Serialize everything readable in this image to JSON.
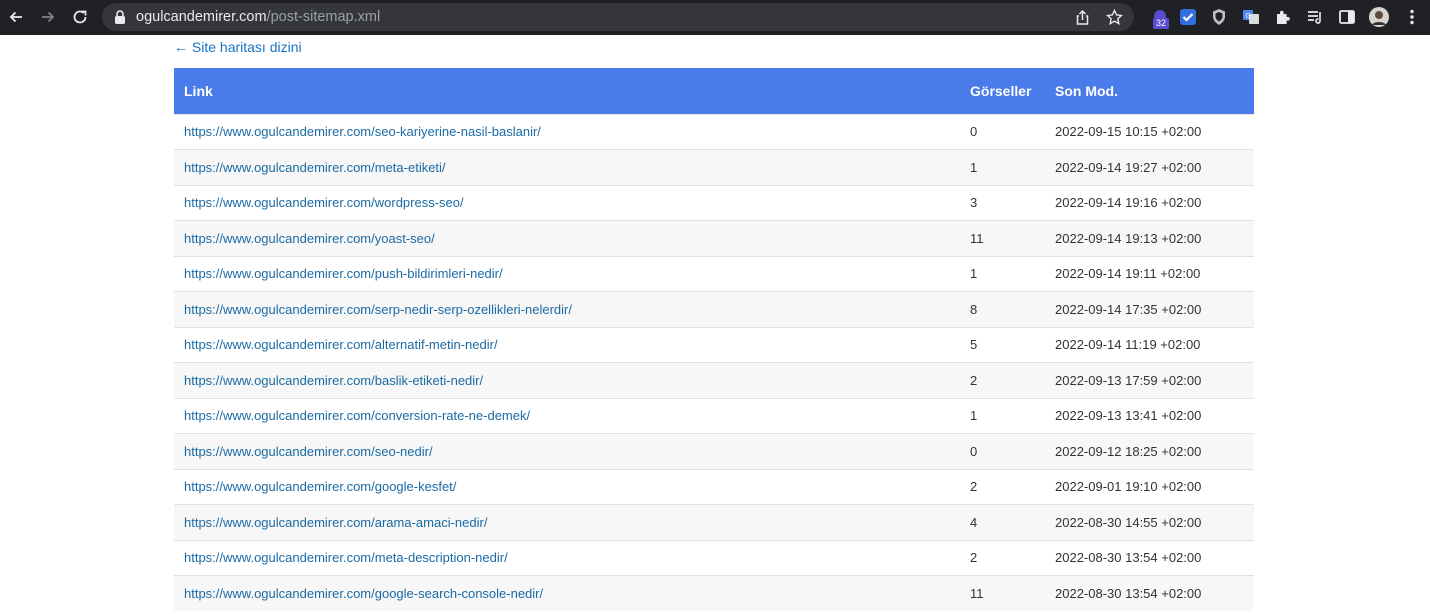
{
  "browser": {
    "url_host": "ogulcandemirer.com",
    "url_path": "/post-sitemap.xml",
    "extension_badge": "32"
  },
  "page": {
    "back_link": "← Site haritası dizini",
    "table": {
      "headers": [
        "Link",
        "Görseller",
        "Son Mod."
      ],
      "rows": [
        {
          "link": "https://www.ogulcandemirer.com/seo-kariyerine-nasil-baslanir/",
          "images": "0",
          "modified": "2022-09-15 10:15 +02:00"
        },
        {
          "link": "https://www.ogulcandemirer.com/meta-etiketi/",
          "images": "1",
          "modified": "2022-09-14 19:27 +02:00"
        },
        {
          "link": "https://www.ogulcandemirer.com/wordpress-seo/",
          "images": "3",
          "modified": "2022-09-14 19:16 +02:00"
        },
        {
          "link": "https://www.ogulcandemirer.com/yoast-seo/",
          "images": "11",
          "modified": "2022-09-14 19:13 +02:00"
        },
        {
          "link": "https://www.ogulcandemirer.com/push-bildirimleri-nedir/",
          "images": "1",
          "modified": "2022-09-14 19:11 +02:00"
        },
        {
          "link": "https://www.ogulcandemirer.com/serp-nedir-serp-ozellikleri-nelerdir/",
          "images": "8",
          "modified": "2022-09-14 17:35 +02:00"
        },
        {
          "link": "https://www.ogulcandemirer.com/alternatif-metin-nedir/",
          "images": "5",
          "modified": "2022-09-14 11:19 +02:00"
        },
        {
          "link": "https://www.ogulcandemirer.com/baslik-etiketi-nedir/",
          "images": "2",
          "modified": "2022-09-13 17:59 +02:00"
        },
        {
          "link": "https://www.ogulcandemirer.com/conversion-rate-ne-demek/",
          "images": "1",
          "modified": "2022-09-13 13:41 +02:00"
        },
        {
          "link": "https://www.ogulcandemirer.com/seo-nedir/",
          "images": "0",
          "modified": "2022-09-12 18:25 +02:00"
        },
        {
          "link": "https://www.ogulcandemirer.com/google-kesfet/",
          "images": "2",
          "modified": "2022-09-01 19:10 +02:00"
        },
        {
          "link": "https://www.ogulcandemirer.com/arama-amaci-nedir/",
          "images": "4",
          "modified": "2022-08-30 14:55 +02:00"
        },
        {
          "link": "https://www.ogulcandemirer.com/meta-description-nedir/",
          "images": "2",
          "modified": "2022-08-30 13:54 +02:00"
        },
        {
          "link": "https://www.ogulcandemirer.com/google-search-console-nedir/",
          "images": "11",
          "modified": "2022-08-30 13:54 +02:00"
        }
      ]
    }
  }
}
